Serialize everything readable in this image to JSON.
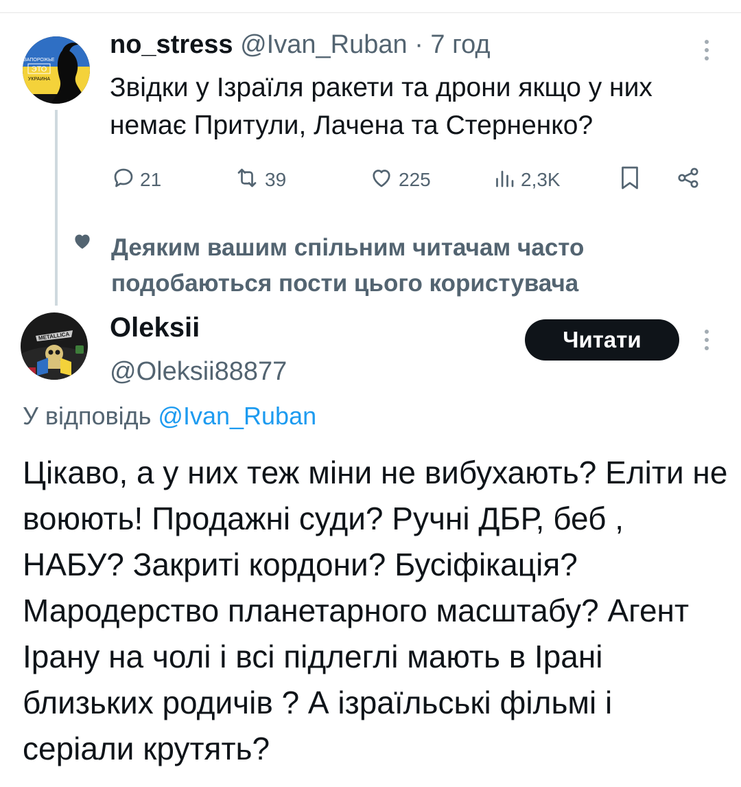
{
  "tweet": {
    "author_name": "no_stress",
    "author_handle": "@Ivan_Ruban",
    "separator": "·",
    "time": "7 год",
    "text": "Звідки у Ізраїля ракети та дрони якщо у них немає Притули, Лачена та Стерненко?",
    "avatar_text": [
      "ЗАПОРОЖЬЕ",
      "ЭТО",
      "УКРАИНА"
    ],
    "actions": {
      "replies": "21",
      "retweets": "39",
      "likes": "225",
      "views": "2,3K"
    }
  },
  "social_context": {
    "text": "Деяким вашим спільним читачам часто подобаються пости цього користувача"
  },
  "reply": {
    "author_name": "Oleksii",
    "author_handle": "@Oleksii88877",
    "follow_label": "Читати",
    "avatar_text": "METALLICA",
    "reply_prefix": "У відповідь",
    "reply_to": "@Ivan_Ruban",
    "text": "Цікаво, а у них теж міни не вибухають? Еліти не воюють! Продажні суди? Ручні ДБР, беб , НАБУ? Закриті кордони? Бусіфікація? Мародерство планетарного масштабу? Агент Ірану на чолі і всі підлеглі мають в Ірані близьких родичів ? А ізраїльські фільмі і серіали крутять?"
  },
  "colors": {
    "text": "#0f1419",
    "muted": "#536471",
    "link": "#1d9bf0",
    "button_bg": "#0f1419",
    "thread_line": "#cfd9de"
  },
  "icons": [
    "reply-icon",
    "retweet-icon",
    "like-icon",
    "views-icon",
    "bookmark-icon",
    "share-icon",
    "heart-icon",
    "more-icon"
  ]
}
